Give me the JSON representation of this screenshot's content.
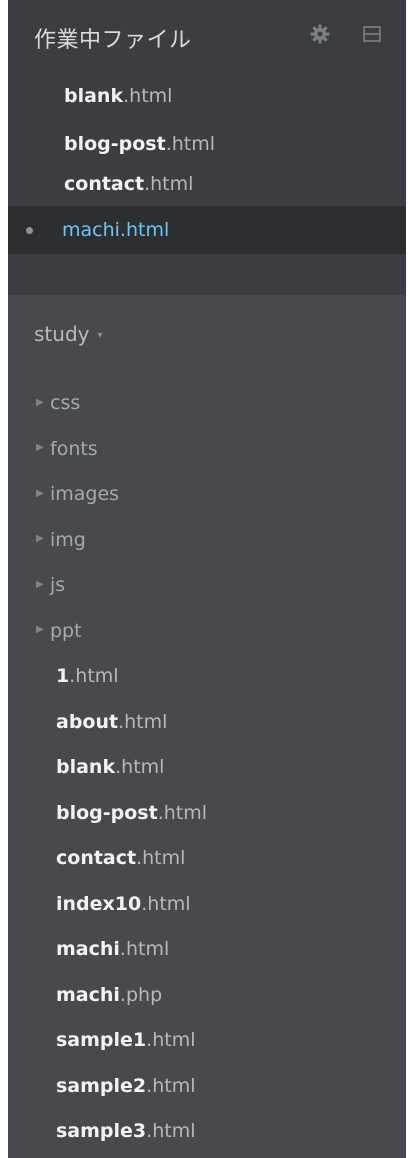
{
  "working_files": {
    "title": "作業中ファイル",
    "icons": {
      "settings": "gear-icon",
      "split": "split-view-icon"
    },
    "items": [
      {
        "name": "blank",
        "ext": ".html",
        "selected": false
      },
      {
        "name": "blog-post",
        "ext": ".html",
        "selected": false
      },
      {
        "name": "contact",
        "ext": ".html",
        "selected": false
      },
      {
        "name": "machi",
        "ext": ".html",
        "selected": true
      }
    ]
  },
  "project": {
    "name": "study",
    "caret": "▾",
    "folders": [
      {
        "name": "css",
        "arrow": "▶"
      },
      {
        "name": "fonts",
        "arrow": "▶"
      },
      {
        "name": "images",
        "arrow": "▶"
      },
      {
        "name": "img",
        "arrow": "▶"
      },
      {
        "name": "js",
        "arrow": "▶"
      },
      {
        "name": "ppt",
        "arrow": "▶"
      }
    ],
    "files": [
      {
        "name": "1",
        "ext": ".html"
      },
      {
        "name": "about",
        "ext": ".html"
      },
      {
        "name": "blank",
        "ext": ".html"
      },
      {
        "name": "blog-post",
        "ext": ".html"
      },
      {
        "name": "contact",
        "ext": ".html"
      },
      {
        "name": "index10",
        "ext": ".html"
      },
      {
        "name": "machi",
        "ext": ".html"
      },
      {
        "name": "machi",
        "ext": ".php"
      },
      {
        "name": "sample1",
        "ext": ".html"
      },
      {
        "name": "sample2",
        "ext": ".html"
      },
      {
        "name": "sample3",
        "ext": ".html"
      }
    ]
  },
  "colors": {
    "sidebar_bg": "#47494e",
    "working_files_bg": "#3c3d42",
    "selected_bg": "#2d2e32",
    "selected_text": "#6cc6f2"
  }
}
